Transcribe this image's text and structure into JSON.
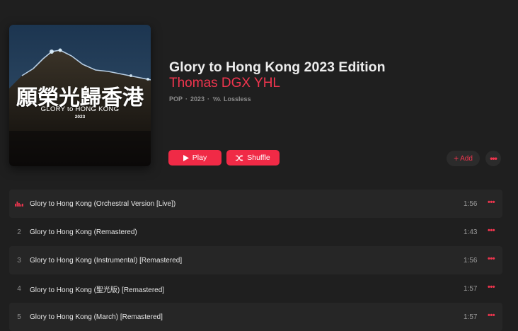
{
  "album": {
    "art_title_cjk": "願榮光歸香港",
    "art_subtitle": "GLORY to HONG KONG",
    "art_year": "2023",
    "title": "Glory to Hong Kong 2023 Edition",
    "artist": "Thomas DGX YHL",
    "meta_genre": "POP",
    "meta_sep": "·",
    "meta_year": "2023",
    "meta_quality": "Lossless"
  },
  "actions": {
    "play_label": "Play",
    "shuffle_label": "Shuffle",
    "add_label": "Add",
    "more_label": "•••"
  },
  "tracks": [
    {
      "number": "",
      "title": "Glory to Hong Kong (Orchestral Version [Live])",
      "duration": "1:56",
      "playing": true
    },
    {
      "number": "2",
      "title": "Glory to Hong Kong (Remastered)",
      "duration": "1:43",
      "playing": false
    },
    {
      "number": "3",
      "title": "Glory to Hong Kong (Instrumental) [Remastered]",
      "duration": "1:56",
      "playing": false
    },
    {
      "number": "4",
      "title": "Glory to Hong Kong (聖光版) [Remastered]",
      "duration": "1:57",
      "playing": false
    },
    {
      "number": "5",
      "title": "Glory to Hong Kong (March) [Remastered]",
      "duration": "1:57",
      "playing": false
    }
  ],
  "track_more_label": "•••",
  "colors": {
    "accent": "#f0354e",
    "button": "#f02a46",
    "background": "#1f1f1f"
  }
}
